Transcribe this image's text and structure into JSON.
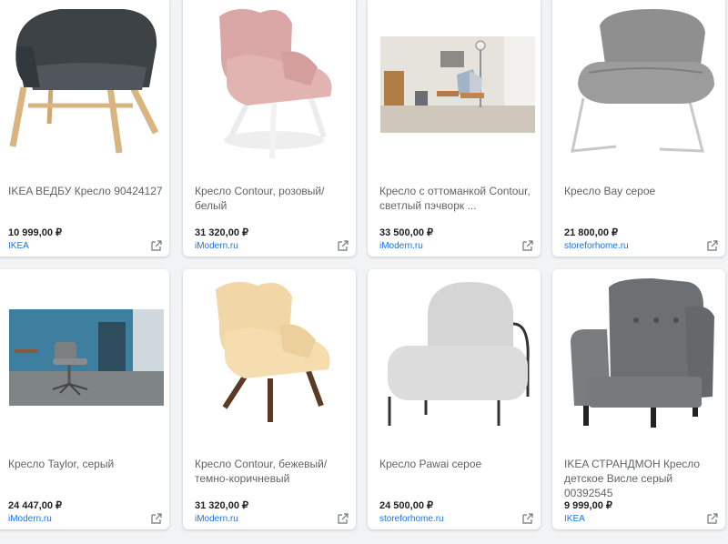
{
  "products": [
    {
      "title": "IKEA ВЕДБУ Кресло 90424127",
      "price": "10 999,00 ₽",
      "store": "IKEA",
      "icon": "dark-grey-armchair-wooden-legs"
    },
    {
      "title": "Кресло Contour, розовый/белый",
      "price": "31 320,00 ₽",
      "store": "iModern.ru",
      "icon": "pink-wingback-chair-white-legs"
    },
    {
      "title": "Кресло с оттоманкой Contour, светлый пэчворк ...",
      "price": "33 500,00 ₽",
      "store": "iModern.ru",
      "icon": "patchwork-chair-with-ottoman-room-photo"
    },
    {
      "title": "Кресло Bay серое",
      "price": "21 800,00 ₽",
      "store": "storeforhome.ru",
      "icon": "grey-lounge-chair-sled-base"
    },
    {
      "title": "Кресло Taylor, серый",
      "price": "24 447,00 ₽",
      "store": "iModern.ru",
      "icon": "grey-office-chair-blue-room"
    },
    {
      "title": "Кресло Contour, бежевый/ темно-коричневый",
      "price": "31 320,00 ₽",
      "store": "iModern.ru",
      "icon": "beige-wingback-chair-brown-legs"
    },
    {
      "title": "Кресло Pawai серое",
      "price": "24 500,00 ₽",
      "store": "storeforhome.ru",
      "icon": "light-grey-round-back-chair"
    },
    {
      "title": "IKEA СТРАНДМОН Кресло детское Висле серый 00392545",
      "price": "9 999,00 ₽",
      "store": "IKEA",
      "icon": "grey-wingback-armchair"
    }
  ],
  "colors": {
    "link": "#1a73e8",
    "price": "#202124",
    "title": "#5f6368",
    "background": "#f1f3f4"
  }
}
